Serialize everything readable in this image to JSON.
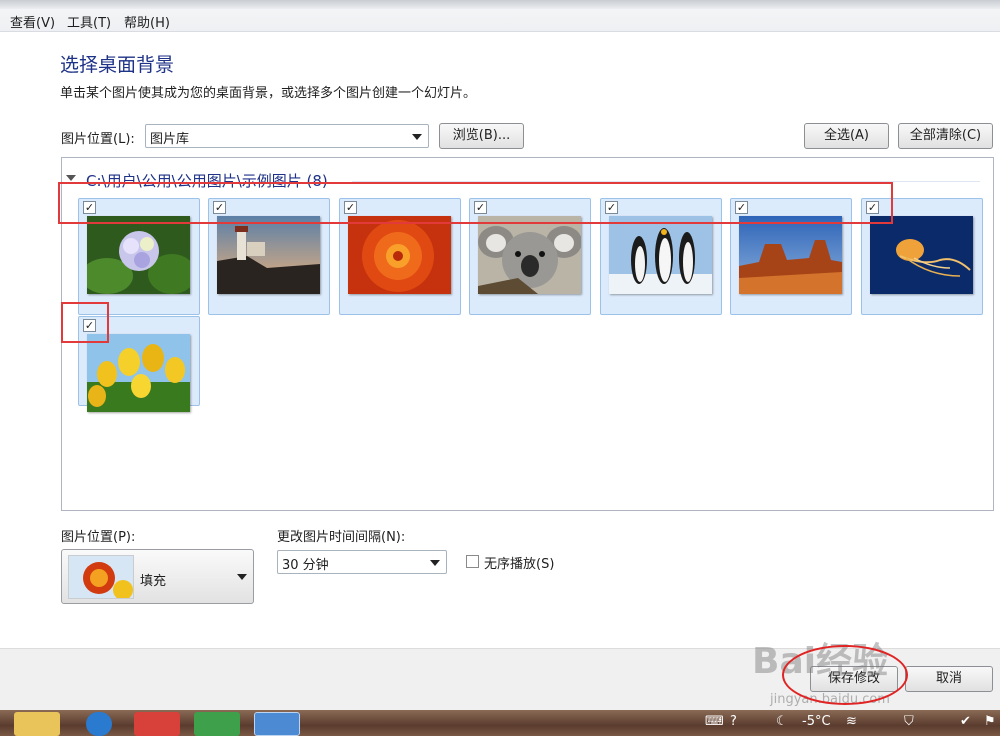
{
  "menu": {
    "view": "查看(V)",
    "tools": "工具(T)",
    "help": "帮助(H)"
  },
  "page": {
    "title": "选择桌面背景",
    "subtitle": "单击某个图片使其成为您的桌面背景，或选择多个图片创建一个幻灯片。"
  },
  "location": {
    "label": "图片位置(L):",
    "value": "图片库",
    "browse_label": "浏览(B)...",
    "select_all_label": "全选(A)",
    "clear_all_label": "全部清除(C)"
  },
  "gallery": {
    "group_header": "C:\\用户\\公用\\公用图片\\示例图片 (8)",
    "check_mark": "✓",
    "items": [
      {
        "name": "Hydrangeas",
        "checked": true
      },
      {
        "name": "Lighthouse",
        "checked": true
      },
      {
        "name": "Chrysanthemum",
        "checked": true
      },
      {
        "name": "Koala",
        "checked": true
      },
      {
        "name": "Penguins",
        "checked": true
      },
      {
        "name": "Desert",
        "checked": true
      },
      {
        "name": "Jellyfish",
        "checked": true
      },
      {
        "name": "Tulips",
        "checked": true
      }
    ]
  },
  "position": {
    "label": "图片位置(P):",
    "value": "填充"
  },
  "interval": {
    "label": "更改图片时间间隔(N):",
    "value": "30 分钟"
  },
  "shuffle": {
    "label": "无序播放(S)",
    "checked": false
  },
  "footer": {
    "save_label": "保存修改",
    "cancel_label": "取消"
  },
  "watermark": {
    "logo": "Bai经验",
    "url": "jingyan.baidu.com"
  },
  "tray": {
    "temperature": "-5°C"
  },
  "colors": {
    "accent": "#1e3287",
    "highlight": "#e23a3a",
    "tile": "#dcebfc"
  }
}
